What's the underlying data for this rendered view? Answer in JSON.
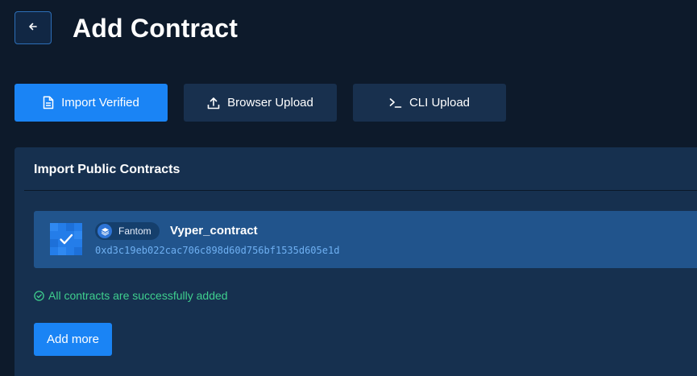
{
  "header": {
    "title": "Add Contract"
  },
  "tabs": [
    {
      "label": "Import Verified",
      "icon": "document-icon",
      "active": true
    },
    {
      "label": "Browser Upload",
      "icon": "upload-icon",
      "active": false
    },
    {
      "label": "CLI Upload",
      "icon": "terminal-icon",
      "active": false
    }
  ],
  "import_card": {
    "title": "Import Public Contracts",
    "contracts": [
      {
        "network": "Fantom",
        "name": "Vyper_contract",
        "address": "0xd3c19eb022cac706c898d60d756bf1535d605e1d",
        "selected": true
      }
    ],
    "status_message": "All contracts are successfully added",
    "add_more_label": "Add more"
  },
  "colors": {
    "accent": "#1a84f5",
    "success": "#3fcf8e",
    "background": "#0d1a2b",
    "card": "#16304f",
    "row": "#21548c"
  }
}
